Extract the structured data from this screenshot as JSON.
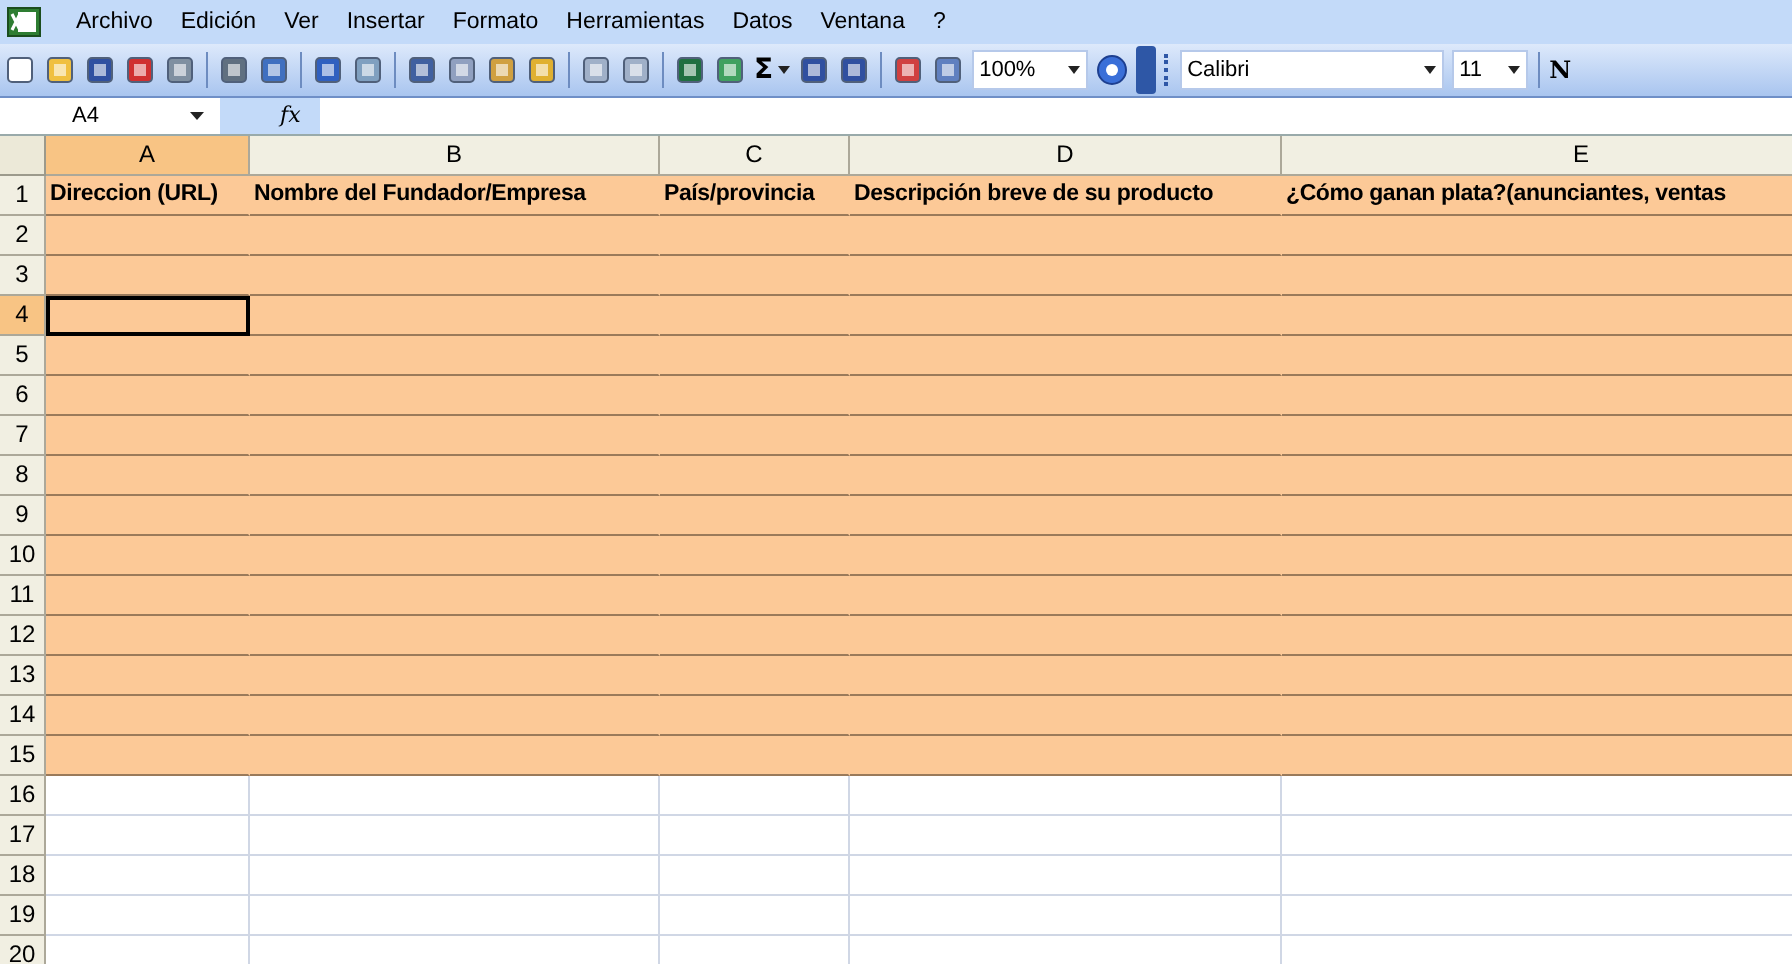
{
  "menu": [
    "Archivo",
    "Edición",
    "Ver",
    "Insertar",
    "Formato",
    "Herramientas",
    "Datos",
    "Ventana",
    "?"
  ],
  "toolbar": {
    "sum": "Σ",
    "zoom": "100%",
    "font": "Calibri",
    "size": "11",
    "bold": "N"
  },
  "name_box": "A4",
  "fx": "fx",
  "columns": [
    {
      "label": "A",
      "selected": true
    },
    {
      "label": "B",
      "selected": false
    },
    {
      "label": "C",
      "selected": false
    },
    {
      "label": "D",
      "selected": false
    },
    {
      "label": "E",
      "selected": false
    }
  ],
  "rows": [
    {
      "number": "1",
      "filled": true,
      "selected": false,
      "cells": [
        "Direccion (URL)",
        "Nombre del Fundador/Empresa",
        "País/provincia",
        "Descripción breve de su producto",
        "¿Cómo ganan plata?(anunciantes, ventas"
      ]
    },
    {
      "number": "2",
      "filled": true,
      "selected": false
    },
    {
      "number": "3",
      "filled": true,
      "selected": false
    },
    {
      "number": "4",
      "filled": true,
      "selected": true
    },
    {
      "number": "5",
      "filled": true,
      "selected": false
    },
    {
      "number": "6",
      "filled": true,
      "selected": false
    },
    {
      "number": "7",
      "filled": true,
      "selected": false
    },
    {
      "number": "8",
      "filled": true,
      "selected": false
    },
    {
      "number": "9",
      "filled": true,
      "selected": false
    },
    {
      "number": "10",
      "filled": true,
      "selected": false
    },
    {
      "number": "11",
      "filled": true,
      "selected": false
    },
    {
      "number": "12",
      "filled": true,
      "selected": false
    },
    {
      "number": "13",
      "filled": true,
      "selected": false
    },
    {
      "number": "14",
      "filled": true,
      "selected": false
    },
    {
      "number": "15",
      "filled": true,
      "selected": false
    },
    {
      "number": "16",
      "filled": false,
      "selected": false
    },
    {
      "number": "17",
      "filled": false,
      "selected": false
    },
    {
      "number": "18",
      "filled": false,
      "selected": false
    },
    {
      "number": "19",
      "filled": false,
      "selected": false
    },
    {
      "number": "20",
      "filled": false,
      "selected": false
    }
  ]
}
